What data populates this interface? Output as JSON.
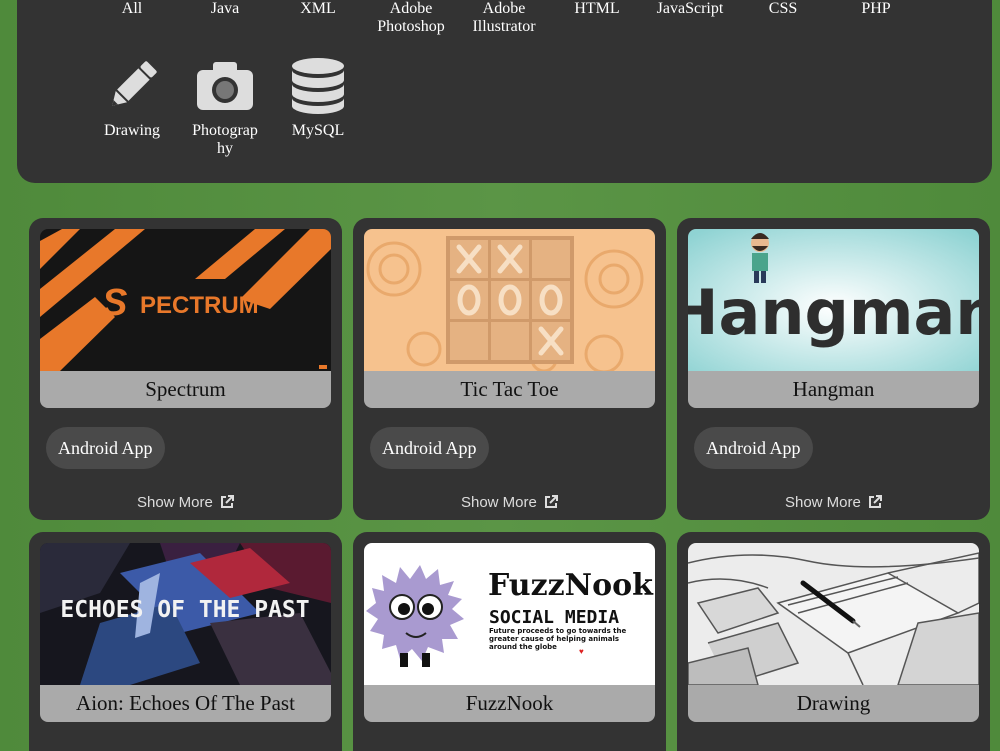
{
  "filters_row1": [
    "All",
    "Java",
    "XML",
    "Adobe\nPhotoshop",
    "Adobe\nIllustrator",
    "HTML",
    "JavaScript",
    "CSS",
    "PHP"
  ],
  "filters_row2": [
    {
      "label": "Drawing",
      "icon": "pencil-icon"
    },
    {
      "label": "Photograp\nhy",
      "icon": "camera-icon"
    },
    {
      "label": "MySQL",
      "icon": "database-icon"
    }
  ],
  "projects": [
    {
      "title": "Spectrum",
      "tag": "Android App",
      "more": "Show More",
      "thumb_text": "PECTRUM",
      "thumb_letter": "S"
    },
    {
      "title": "Tic Tac Toe",
      "tag": "Android App",
      "more": "Show More"
    },
    {
      "title": "Hangman",
      "tag": "Android App",
      "more": "Show More",
      "thumb_text": "Hangman"
    },
    {
      "title": "Aion: Echoes Of The Past",
      "thumb_text": "ECHOES OF THE PAST"
    },
    {
      "title": "FuzzNook",
      "thumb_text": "FuzzNook",
      "thumb_sub": "SOCIAL MEDIA",
      "thumb_desc": "Future proceeds to go towards the greater cause of helping animals around the globe"
    },
    {
      "title": "Drawing"
    }
  ],
  "colors": {
    "panel": "#333333",
    "title_bar": "#aaaaaa",
    "tag": "#4a4a4a",
    "background": "#569140"
  }
}
